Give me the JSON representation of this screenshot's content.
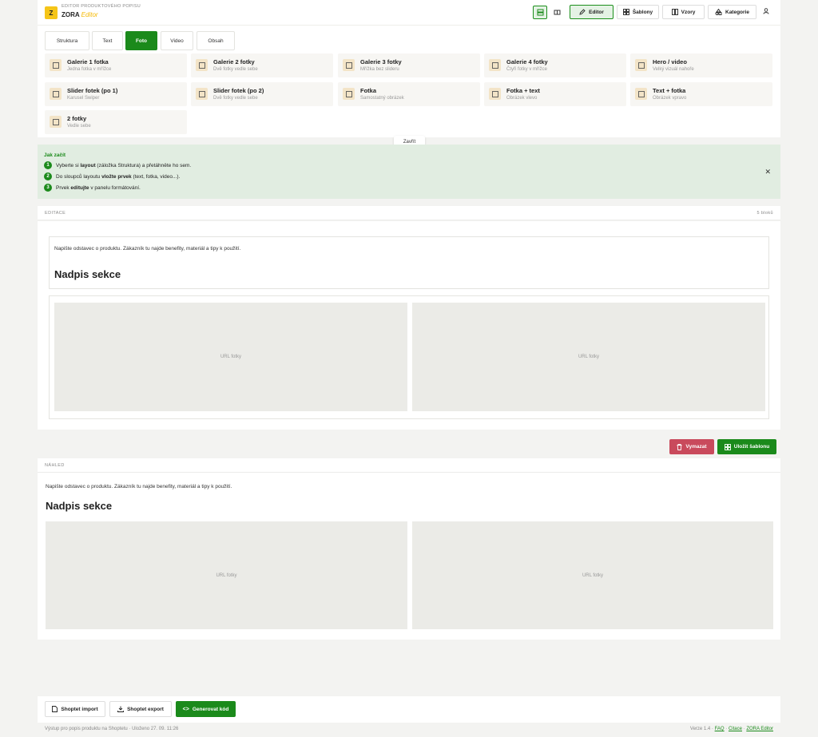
{
  "header": {
    "subtitle": "EDITOR PRODUKTOVÉHO POPISU",
    "brand": "ZORA",
    "brand_suffix": "Editor",
    "logo_letter": "Z",
    "nav": [
      {
        "label": "Editor",
        "icon": "pencil-icon"
      },
      {
        "label": "Šablony",
        "icon": "template-icon"
      },
      {
        "label": "Vzory",
        "icon": "columns-icon"
      },
      {
        "label": "Kategorie",
        "icon": "shapes-icon"
      }
    ]
  },
  "tabs": [
    "Struktura",
    "Text",
    "Foto",
    "Video",
    "Obsah"
  ],
  "active_tab": "Foto",
  "tiles": [
    {
      "name": "Galerie 1 fotka",
      "desc": "Jedna fotka v mřížce",
      "icon": "image-icon"
    },
    {
      "name": "Galerie 2 fotky",
      "desc": "Dvě fotky vedle sebe",
      "icon": "copy-icon"
    },
    {
      "name": "Galerie 3 fotky",
      "desc": "Mřížka bez slideru",
      "icon": "grid-icon"
    },
    {
      "name": "Galerie 4 fotky",
      "desc": "Čtyři fotky v mřížce",
      "icon": "grid4-icon"
    },
    {
      "name": "Hero / video",
      "desc": "Velký vizuál nahoře",
      "icon": "hero-icon"
    },
    {
      "name": "Slider fotek (po 1)",
      "desc": "Karusel Swiper",
      "icon": "slider-icon"
    },
    {
      "name": "Slider fotek (po 2)",
      "desc": "Dvě fotky vedle sebe",
      "icon": "slider2-icon"
    },
    {
      "name": "Fotka",
      "desc": "Samostatný obrázek",
      "icon": "photo-icon"
    },
    {
      "name": "Fotka + text",
      "desc": "Obrázek vlevo",
      "icon": "photo-text-icon"
    },
    {
      "name": "Text + fotka",
      "desc": "Obrázek vpravo",
      "icon": "text-photo-icon"
    },
    {
      "name": "2 fotky",
      "desc": "Vedle sebe",
      "icon": "copy-icon"
    }
  ],
  "close_label": "Zavřít",
  "howto": {
    "title": "Jak začít",
    "steps": [
      {
        "num": "1",
        "pre": "Vyberte si ",
        "bold": "layout",
        "post": " (záložka Struktura) a přetáhněte ho sem."
      },
      {
        "num": "2",
        "pre": "Do sloupců layoutu ",
        "bold": "vložte prvek",
        "post": " (text, fotka, video...)."
      },
      {
        "num": "3",
        "pre": "Prvek ",
        "bold": "editujte",
        "post": " v panelu formátování."
      }
    ]
  },
  "edit": {
    "label": "EDITACE",
    "count": "5 bloků",
    "paragraph": "Napište odstavec o produktu. Zákazník tu najde benefity, materiál a tipy k použití.",
    "heading": "Nadpis sekce",
    "img_placeholder": "URL fotky"
  },
  "actions": {
    "delete": "Vymazat",
    "save_template": "Uložit šablonu",
    "delete_color": "#c94a5c",
    "save_color": "#1b8a1b"
  },
  "preview": {
    "label": "NÁHLED",
    "paragraph": "Napište odstavec o produktu. Zákazník tu najde benefity, materiál a tipy k použití.",
    "heading": "Nadpis sekce",
    "img_placeholder": "URL fotky"
  },
  "footer": {
    "import": "Shoptet import",
    "export": "Shoptet export",
    "generate": "Generovat kód",
    "status_left": "Výstup pro popis produktu na Shoptetu · Uloženo 27. 09. 11:26",
    "version": "Verze 1.4 ·",
    "link_faq": "FAQ",
    "link_cit": "Citace",
    "link_zora": "ZORA Editor"
  },
  "colors": {
    "accent": "#1b8a1b",
    "brand": "#f5c518"
  }
}
